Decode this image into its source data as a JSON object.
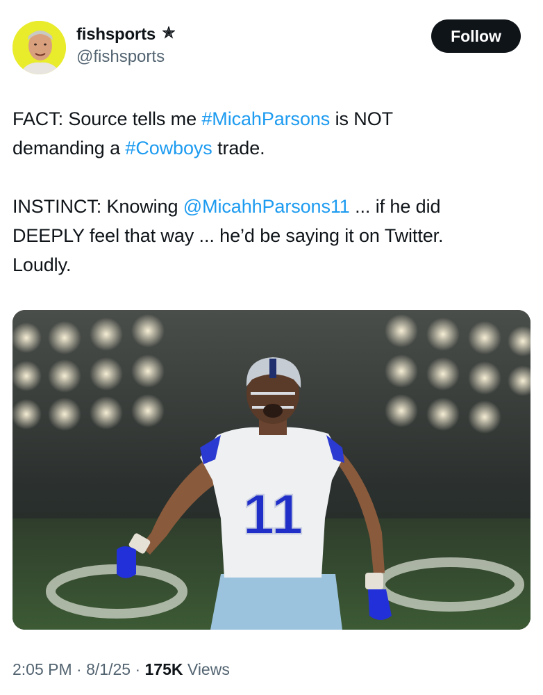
{
  "author": {
    "display_name": "fishsports",
    "handle": "@fishsports",
    "avatar_icon": "profile-photo",
    "badge_icon": "star-icon"
  },
  "follow_button": {
    "label": "Follow"
  },
  "tweet": {
    "p1_a": "FACT: Source tells me ",
    "p1_link1": "#MicahParsons",
    "p1_b": " is NOT",
    "p1_c": "demanding a ",
    "p1_link2": "#Cowboys",
    "p1_d": " trade.",
    "p2_a": "INSTINCT: Knowing ",
    "p2_link": "@MicahhParsons11",
    "p2_b": " ... if he did",
    "p2_c": "DEEPLY feel that way ... he’d be saying it on Twitter.",
    "p2_d": "Loudly."
  },
  "media": {
    "jersey_number": "11"
  },
  "meta": {
    "time": "2:05 PM",
    "separator": " · ",
    "date": "8/1/25",
    "views_count": "175K",
    "views_label": " Views"
  },
  "colors": {
    "link": "#1d9bf0",
    "button_bg": "#0f1419",
    "meta_text": "#536471",
    "avatar_bg": "#e9ec2a"
  }
}
